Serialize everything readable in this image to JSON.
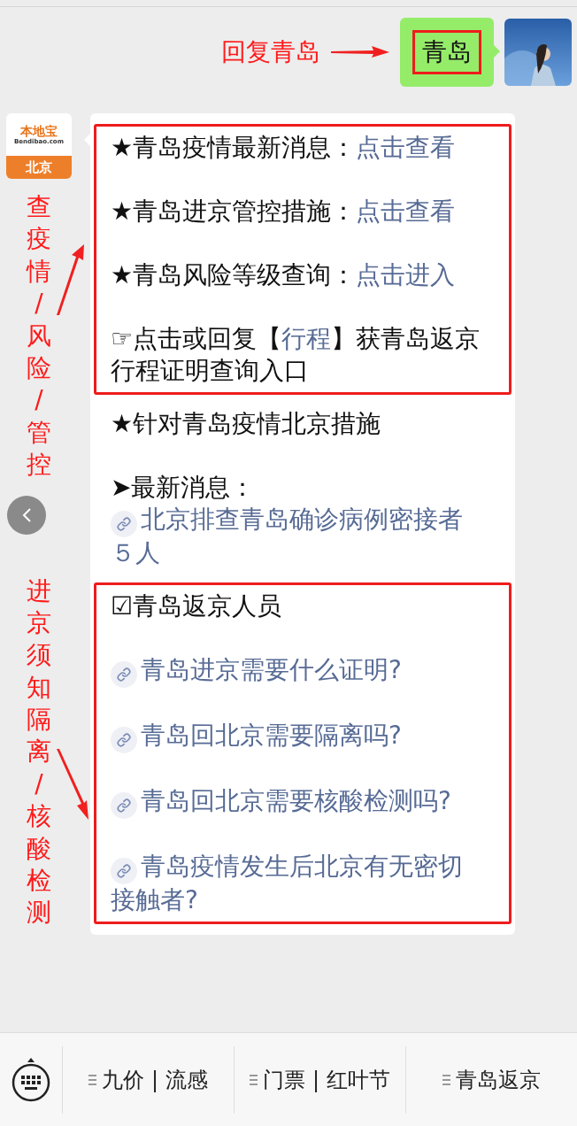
{
  "reply": {
    "annotation": "回复青岛",
    "message": "青岛"
  },
  "sender_logo": {
    "name": "本地宝",
    "domain": "Bendibao.com",
    "city": "北京"
  },
  "side_annotations": [
    "查疫情/风险/管控",
    "进京须知隔离/核酸检测"
  ],
  "message_groups": [
    {
      "highlighted": true,
      "items": [
        {
          "parts": [
            {
              "kind": "text",
              "text": "★青岛疫情最新消息："
            },
            {
              "kind": "link",
              "text": "点击查看"
            }
          ]
        },
        {
          "parts": [
            {
              "kind": "text",
              "text": "★青岛进京管控措施："
            },
            {
              "kind": "link",
              "text": "点击查看"
            }
          ]
        },
        {
          "parts": [
            {
              "kind": "text",
              "text": "★青岛风险等级查询："
            },
            {
              "kind": "link",
              "text": "点击进入"
            }
          ]
        },
        {
          "parts": [
            {
              "kind": "text",
              "text": "☞点击或回复【"
            },
            {
              "kind": "link",
              "text": "行程"
            },
            {
              "kind": "text",
              "text": "】获青岛返京行程证明查询入口"
            }
          ]
        }
      ]
    },
    {
      "highlighted": false,
      "items": [
        {
          "parts": [
            {
              "kind": "text",
              "text": "★针对青岛疫情北京措施"
            }
          ]
        },
        {
          "parts": [
            {
              "kind": "text",
              "text": "➤最新消息："
            },
            {
              "kind": "icon_link",
              "text": "北京排查青岛确诊病例密接者５人"
            }
          ]
        }
      ]
    },
    {
      "highlighted": true,
      "items": [
        {
          "parts": [
            {
              "kind": "text",
              "text": "☑青岛返京人员"
            }
          ]
        },
        {
          "parts": [
            {
              "kind": "icon_link",
              "text": "青岛进京需要什么证明?"
            }
          ]
        },
        {
          "parts": [
            {
              "kind": "icon_link",
              "text": "青岛回北京需要隔离吗?"
            }
          ]
        },
        {
          "parts": [
            {
              "kind": "icon_link",
              "text": "青岛回北京需要核酸检测吗?"
            }
          ]
        },
        {
          "parts": [
            {
              "kind": "icon_link",
              "text": "青岛疫情发生后北京有无密切接触者?"
            }
          ]
        }
      ]
    }
  ],
  "menu": [
    "九价 | 流感",
    "门票 | 红叶节",
    "青岛返京"
  ]
}
